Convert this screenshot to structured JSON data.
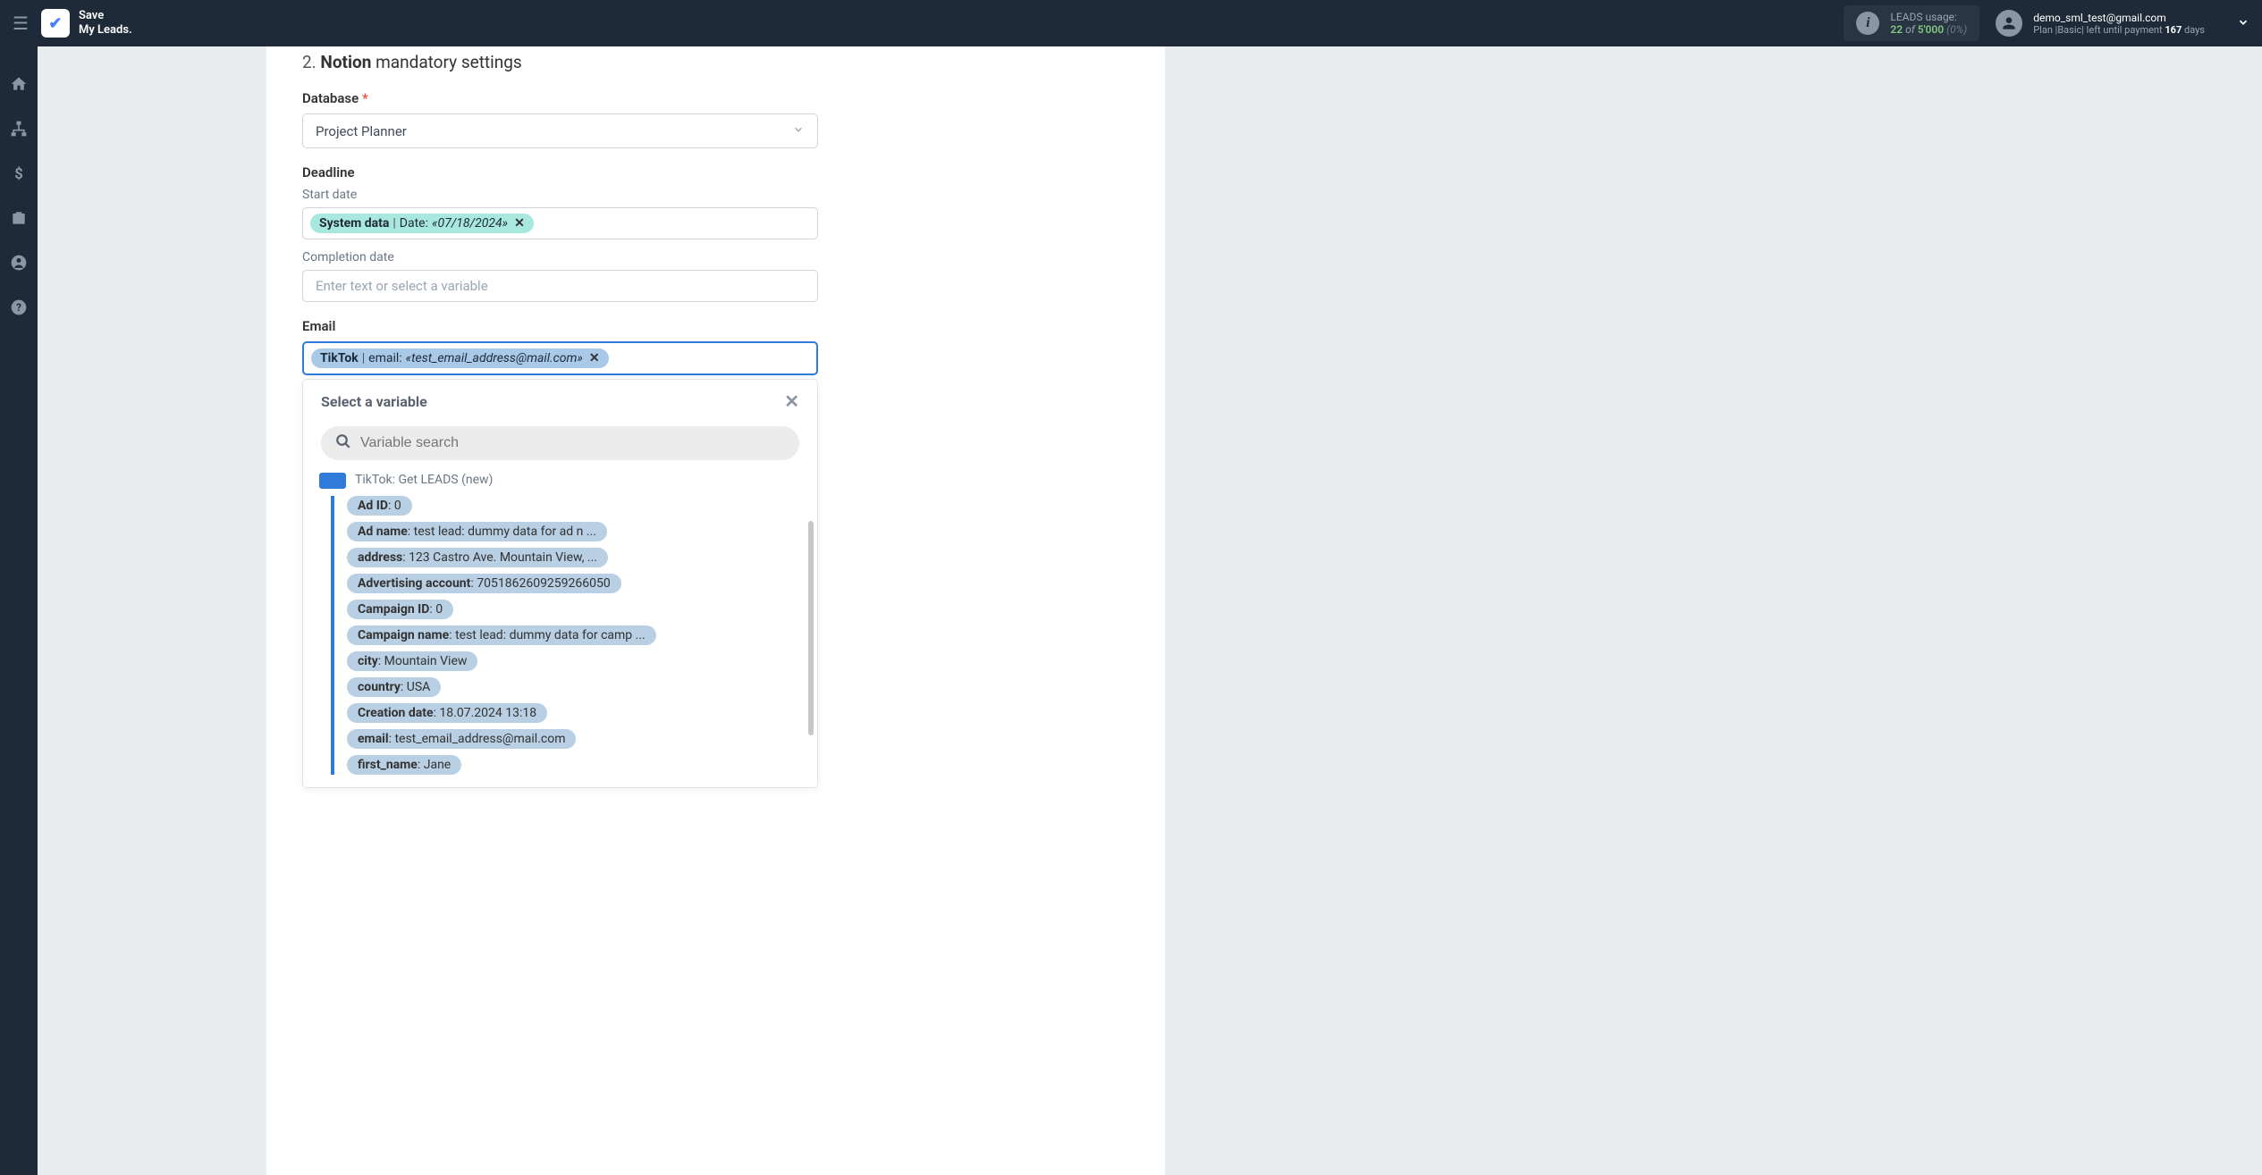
{
  "header": {
    "logo_text": "Save\nMy Leads.",
    "usage_label": "LEADS usage:",
    "usage_current": "22",
    "usage_of": "of",
    "usage_max": "5'000",
    "usage_pct": "(0%)",
    "user_email": "demo_sml_test@gmail.com",
    "user_plan_prefix": "Plan |",
    "user_plan_name": "Basic",
    "user_plan_mid": "|  left until payment",
    "user_plan_days": "167",
    "user_plan_suffix": "days"
  },
  "section": {
    "number": "2.",
    "service": "Notion",
    "title_rest": "mandatory settings"
  },
  "database": {
    "label": "Database",
    "value": "Project Planner"
  },
  "deadline": {
    "label": "Deadline",
    "start_label": "Start date",
    "completion_label": "Completion date",
    "completion_placeholder": "Enter text or select a variable"
  },
  "start_token": {
    "source": "System data",
    "field": "Date:",
    "value": "«07/18/2024»"
  },
  "email": {
    "label": "Email"
  },
  "email_token": {
    "source": "TikTok",
    "field": "email:",
    "value": "«test_email_address@mail.com»"
  },
  "dropdown": {
    "title": "Select a variable",
    "search_placeholder": "Variable search",
    "source_name": "TikTok: Get LEADS (new)",
    "vars": [
      {
        "name": "Ad ID",
        "value": "0"
      },
      {
        "name": "Ad name",
        "value": "test lead: dummy data for ad n ..."
      },
      {
        "name": "address",
        "value": "123 Castro Ave. Mountain View, ..."
      },
      {
        "name": "Advertising account",
        "value": "7051862609259266050"
      },
      {
        "name": "Campaign ID",
        "value": "0"
      },
      {
        "name": "Campaign name",
        "value": "test lead: dummy data for camp ..."
      },
      {
        "name": "city",
        "value": "Mountain View"
      },
      {
        "name": "country",
        "value": "USA"
      },
      {
        "name": "Creation date",
        "value": "18.07.2024 13:18"
      },
      {
        "name": "email",
        "value": "test_email_address@mail.com"
      },
      {
        "name": "first_name",
        "value": "Jane"
      }
    ]
  }
}
